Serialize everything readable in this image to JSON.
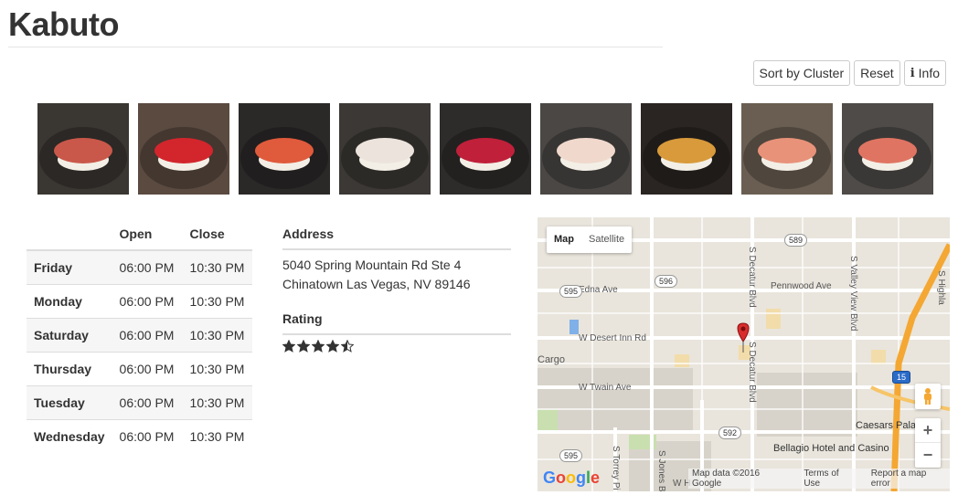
{
  "page_title": "Kabuto",
  "toolbar": {
    "sort_label": "Sort by Cluster",
    "reset_label": "Reset",
    "info_label": "Info"
  },
  "hours": {
    "headers": [
      "",
      "Open",
      "Close"
    ],
    "rows": [
      {
        "day": "Friday",
        "open": "06:00 PM",
        "close": "10:30 PM"
      },
      {
        "day": "Monday",
        "open": "06:00 PM",
        "close": "10:30 PM"
      },
      {
        "day": "Saturday",
        "open": "06:00 PM",
        "close": "10:30 PM"
      },
      {
        "day": "Thursday",
        "open": "06:00 PM",
        "close": "10:30 PM"
      },
      {
        "day": "Tuesday",
        "open": "06:00 PM",
        "close": "10:30 PM"
      },
      {
        "day": "Wednesday",
        "open": "06:00 PM",
        "close": "10:30 PM"
      }
    ]
  },
  "details": {
    "address_heading": "Address",
    "address_line1": "5040 Spring Mountain Rd Ste 4",
    "address_line2": "Chinatown Las Vegas, NV 89146",
    "rating_heading": "Rating",
    "rating_value": 4.5,
    "rating_max": 5
  },
  "map": {
    "tab_map": "Map",
    "tab_satellite": "Satellite",
    "zoom_in": "+",
    "zoom_out": "−",
    "attribution": "Map data ©2016 Google",
    "terms": "Terms of Use",
    "report": "Report a map error",
    "logo": "Google",
    "labels": {
      "edna": "Edna Ave",
      "desert_inn": "W Desert Inn Rd",
      "twain": "W Twain Ave",
      "pennwood": "Pennwood Ave",
      "decatur": "S Decatur Blvd",
      "decatur2": "S Decatur Blvd",
      "valley_view": "S Valley View Blvd",
      "highland": "S Highla",
      "cargo": "Cargo",
      "caesars": "Caesars Pala",
      "bellagio": "Bellagio Hotel and Casino",
      "torrey": "S Torrey Pi",
      "jones": "S Jones B",
      "wh": "W H",
      "r589": "589",
      "r596": "596",
      "r595": "595",
      "r595b": "595",
      "r592": "592",
      "i15": "15"
    }
  },
  "thumbnails": [
    {
      "name": "sushi-photo-1",
      "bg": "#3a3632",
      "fish": "#c9584a"
    },
    {
      "name": "sushi-photo-2",
      "bg": "#5a4a40",
      "fish": "#d2262c"
    },
    {
      "name": "sushi-photo-3",
      "bg": "#2b2928",
      "fish": "#e05a3c"
    },
    {
      "name": "sushi-photo-4",
      "bg": "#3b3835",
      "fish": "#ece4dc"
    },
    {
      "name": "sushi-photo-5",
      "bg": "#2e2c2b",
      "fish": "#c0203a"
    },
    {
      "name": "sushi-photo-6",
      "bg": "#4a4745",
      "fish": "#f0d8cc"
    },
    {
      "name": "sushi-photo-7",
      "bg": "#2a2522",
      "fish": "#d89a3a"
    },
    {
      "name": "sushi-photo-8",
      "bg": "#6a5e52",
      "fish": "#e8927a"
    },
    {
      "name": "sushi-photo-9",
      "bg": "#4e4b48",
      "fish": "#e07462"
    }
  ]
}
